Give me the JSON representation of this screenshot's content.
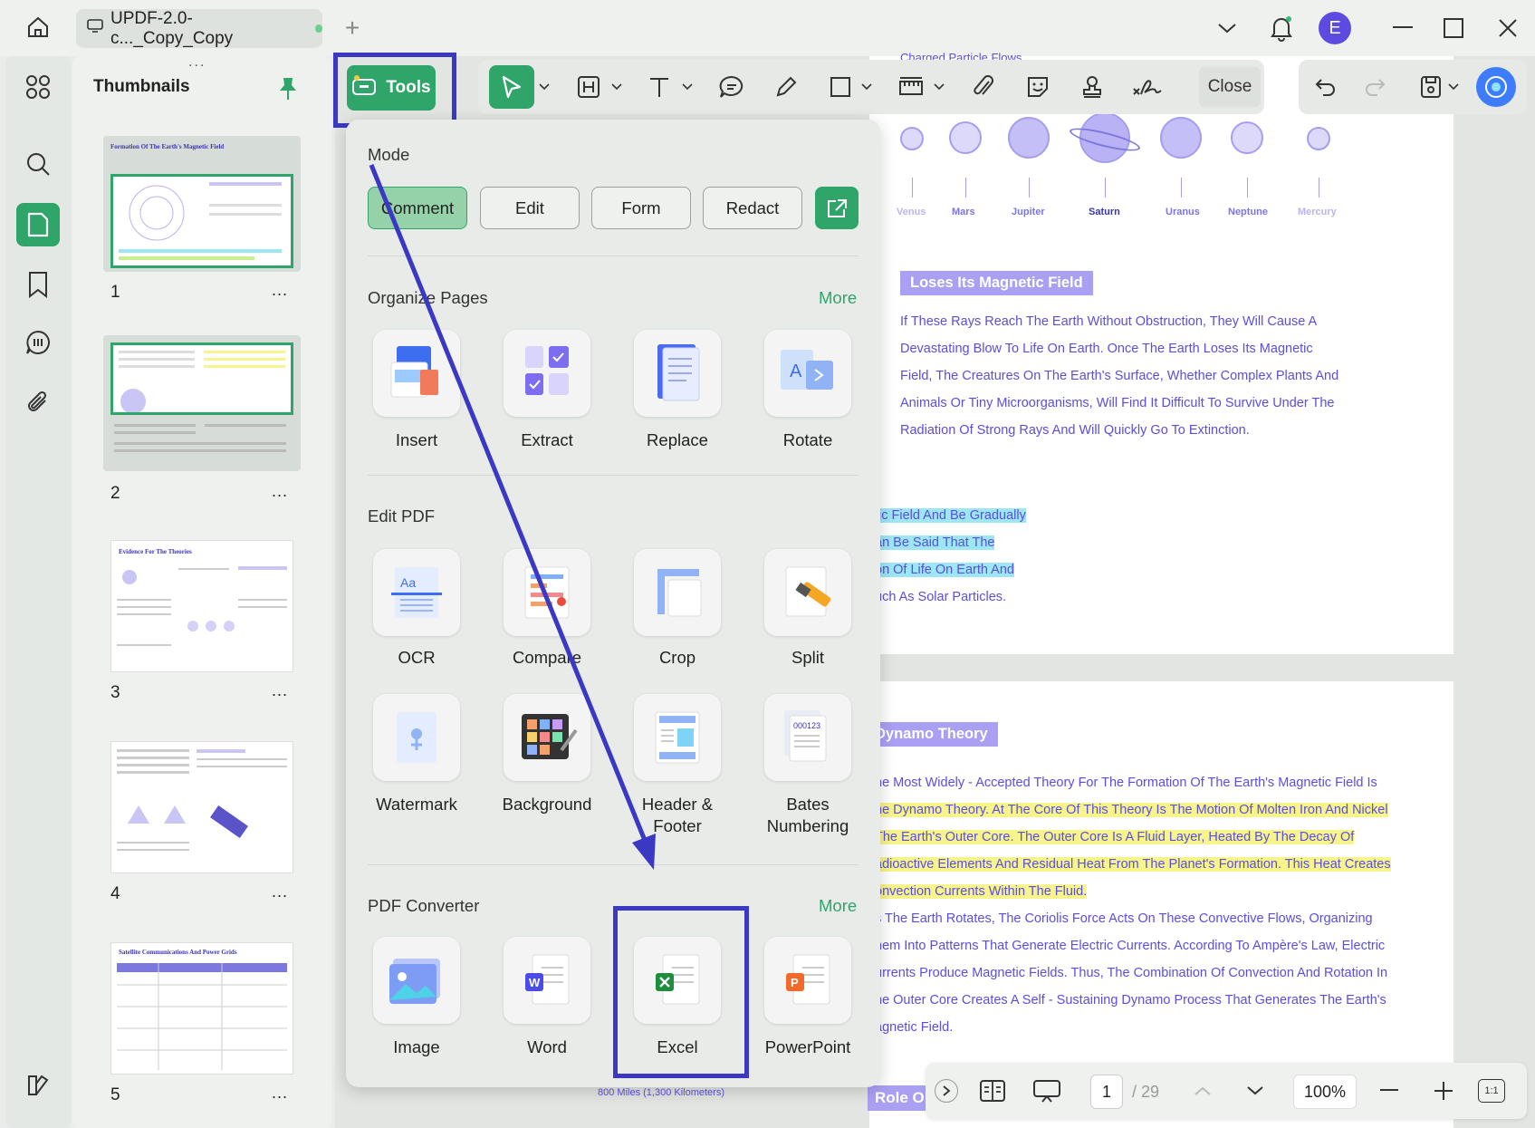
{
  "window": {
    "tab_title": "UPDF-2.0-c..._Copy_Copy",
    "avatar_letter": "E"
  },
  "thumbnails": {
    "title": "Thumbnails",
    "pages": [
      {
        "num": "1",
        "heading": "Formation Of The Earth's Magnetic Field"
      },
      {
        "num": "2",
        "heading": ""
      },
      {
        "num": "3",
        "heading": "Evidence For The Theories"
      },
      {
        "num": "4",
        "heading": ""
      },
      {
        "num": "5",
        "heading": "Satellite Communications And Power Grids"
      }
    ],
    "more": "..."
  },
  "toolbar": {
    "tools_label": "Tools",
    "close_label": "Close"
  },
  "popup": {
    "mode_title": "Mode",
    "modes": [
      "Comment",
      "Edit",
      "Form",
      "Redact"
    ],
    "organize_title": "Organize Pages",
    "organize_more": "More",
    "organize_items": [
      "Insert",
      "Extract",
      "Replace",
      "Rotate"
    ],
    "edit_title": "Edit PDF",
    "edit_items_row1": [
      "OCR",
      "Compare",
      "Crop",
      "Split"
    ],
    "edit_items_row2": [
      "Watermark",
      "Background",
      "Header &\nFooter",
      "Bates\nNumbering"
    ],
    "converter_title": "PDF Converter",
    "converter_more": "More",
    "converter_items": [
      "Image",
      "Word",
      "Excel",
      "PowerPoint"
    ]
  },
  "document": {
    "top_clip": "Charged Particle Flows",
    "planets": [
      "Venus",
      "Mars",
      "Jupiter",
      "Saturn",
      "Uranus",
      "Neptune",
      "Mercury"
    ],
    "section1_title": "Loses Its Magnetic Field",
    "section1_lines": [
      "If These Rays Reach The Earth Without Obstruction, They Will Cause A",
      "Devastating Blow To Life On Earth. Once The Earth Loses Its Magnetic",
      "Field, The Creatures On The Earth's Surface, Whether Complex Plants And",
      "Animals Or Tiny Microorganisms, Will Find It Difficult To Survive Under The",
      "Radiation Of Strong Rays And Will Quickly Go To Extinction."
    ],
    "section1b_lines": [
      "tic Field And Be Gradually",
      "an Be Said That The",
      "on Of Life On Earth And",
      "uch As Solar Particles."
    ],
    "section2_title": "Dynamo Theory",
    "section2_lines": [
      "he Most Widely - Accepted Theory For The Formation Of The Earth's Magnetic Field Is",
      "he Dynamo Theory. At The Core Of This Theory Is The Motion Of Molten Iron And Nickel",
      "The Earth's Outer Core. The Outer Core Is A Fluid Layer, Heated By The Decay Of",
      "adioactive Elements And Residual Heat From The Planet's Formation. This Heat Creates",
      "onvection Currents Within The Fluid.",
      "s The Earth Rotates, The Coriolis Force Acts On These Convective Flows, Organizing",
      "hem Into Patterns That Generate Electric Currents. According To Ampère's Law, Electric",
      "urrents Produce Magnetic Fields. Thus, The Combination Of Convection And Rotation In",
      "he Outer Core Creates A Self - Sustaining Dynamo Process That Generates The Earth's",
      "agnetic Field."
    ],
    "bottom_clip": "800 Miles (1,300 Kilometers)",
    "role_clip": "Role O"
  },
  "bottombar": {
    "page_current": "1",
    "page_total": "/ 29",
    "zoom": "100%",
    "fit_label": "1:1"
  }
}
